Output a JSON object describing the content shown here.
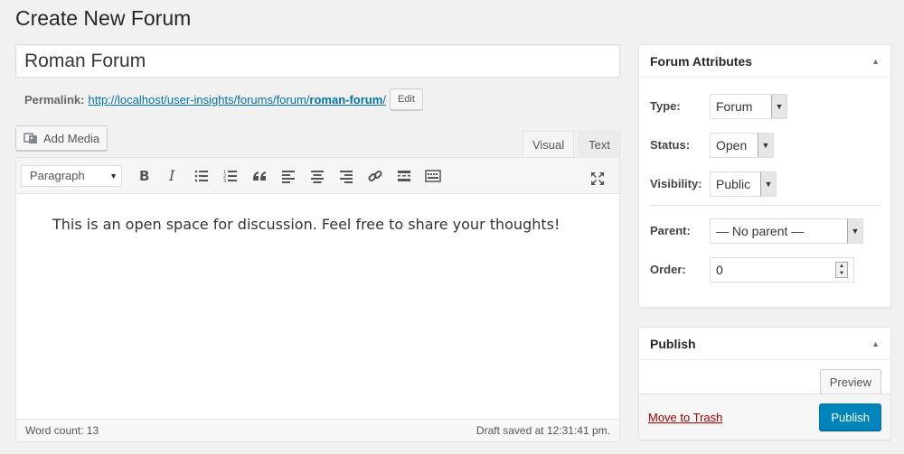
{
  "page": {
    "title": "Create New Forum"
  },
  "post": {
    "title": "Roman Forum"
  },
  "permalink": {
    "label": "Permalink:",
    "base": "http://localhost/user-insights/forums/forum/",
    "slug": "roman-forum",
    "trailing": "/",
    "edit_label": "Edit"
  },
  "editor": {
    "add_media_label": "Add Media",
    "tabs": [
      {
        "label": "Visual",
        "active": true
      },
      {
        "label": "Text",
        "active": false
      }
    ],
    "format_select": "Paragraph",
    "toolbar_icons": [
      "bold-icon",
      "italic-icon",
      "bullet-list-icon",
      "numbered-list-icon",
      "blockquote-icon",
      "align-left-icon",
      "align-center-icon",
      "align-right-icon",
      "link-icon",
      "read-more-icon",
      "toolbar-toggle-icon",
      "fullscreen-icon"
    ],
    "content": "This is an open space for discussion. Feel free to share your thoughts!",
    "word_count": "Word count: 13",
    "draft_status": "Draft saved at 12:31:41 pm."
  },
  "attributes": {
    "title": "Forum Attributes",
    "type": {
      "label": "Type:",
      "value": "Forum"
    },
    "status": {
      "label": "Status:",
      "value": "Open"
    },
    "visibility": {
      "label": "Visibility:",
      "value": "Public"
    },
    "parent": {
      "label": "Parent:",
      "value": "— No parent —"
    },
    "order": {
      "label": "Order:",
      "value": "0"
    }
  },
  "publish": {
    "title": "Publish",
    "preview_label": "Preview",
    "trash_label": "Move to Trash",
    "publish_label": "Publish"
  },
  "colors": {
    "primary": "#0085ba",
    "link": "#0073aa",
    "trash": "#a00000",
    "background": "#f1f1f1"
  }
}
